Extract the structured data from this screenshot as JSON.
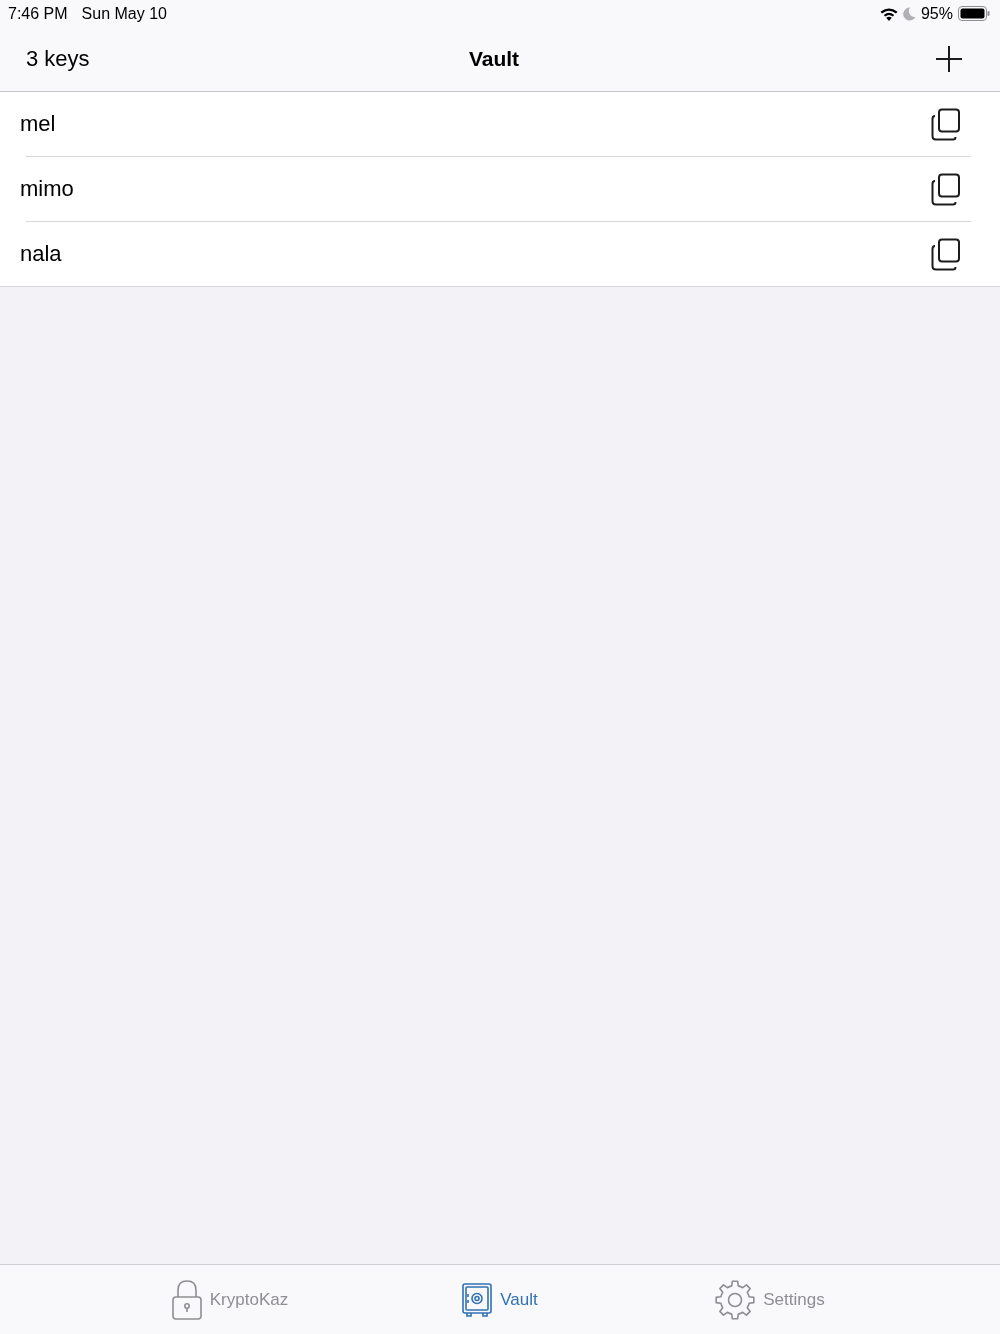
{
  "status_bar": {
    "time": "7:46 PM",
    "date": "Sun May 10",
    "battery": "95%"
  },
  "nav_bar": {
    "left": "3 keys",
    "title": "Vault"
  },
  "keys": [
    {
      "name": "mel"
    },
    {
      "name": "mimo"
    },
    {
      "name": "nala"
    }
  ],
  "tab_bar": [
    {
      "label": "KryptoKaz",
      "kind": "lock",
      "selected": false
    },
    {
      "label": "Vault",
      "kind": "safe",
      "selected": true
    },
    {
      "label": "Settings",
      "kind": "gear",
      "selected": false
    }
  ]
}
